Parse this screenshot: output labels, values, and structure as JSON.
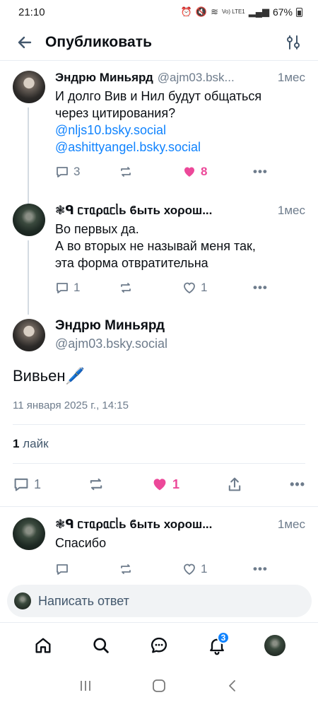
{
  "status_bar": {
    "time": "21:10",
    "signal_label": "Vo) LTE1",
    "battery": "67%"
  },
  "header": {
    "title": "Опубликовать"
  },
  "posts": [
    {
      "author": "Эндрю Миньярд",
      "handle": "@ajm03.bsk...",
      "time": "1мес",
      "text_line1": "И долго Вив и Нил будут общаться",
      "text_line2": "через цитирования?",
      "mention1": "@nljs10.bsky.social",
      "mention2": "@ashittyangel.bsky.social",
      "replies": "3",
      "likes": "8"
    },
    {
      "author": "❃ᑫ ᥴᴛᥲρᥲᥴᥣь ϐыᴛь хоρош...",
      "time": "1мес",
      "text_line1": "Во первых да.",
      "text_line2": "А во вторых не называй меня так,",
      "text_line3": "эта форма отвратительна",
      "replies": "1",
      "likes": "1"
    }
  ],
  "main_post": {
    "author": "Эндрю Миньярд",
    "handle": "@ajm03.bsky.social",
    "text": "Вивьен🖊️",
    "date": "11 января 2025 г., 14:15",
    "likes_count": "1",
    "likes_label": "лайк",
    "replies": "1",
    "likes": "1"
  },
  "reply_post": {
    "author": "❃ᑫ ᥴᴛᥲρᥲᥴᥣь ϐыᴛь хоρош...",
    "time": "1мес",
    "text": "Спасибо",
    "likes": "1"
  },
  "composer": {
    "placeholder": "Написать ответ"
  },
  "nav": {
    "notifications_badge": "3"
  },
  "colors": {
    "accent": "#1083fe",
    "like": "#ec4899",
    "muted": "#6e7c8c"
  }
}
